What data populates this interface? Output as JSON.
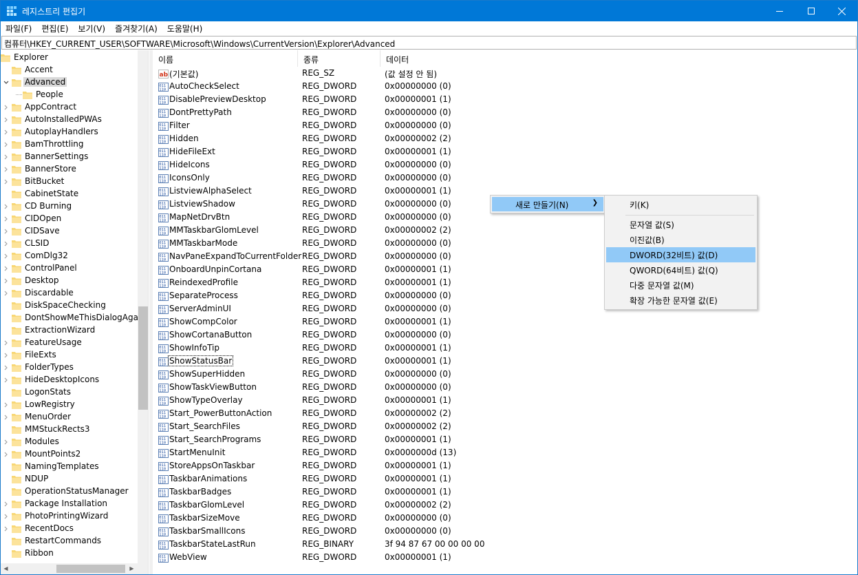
{
  "window": {
    "title": "레지스트리 편집기",
    "controls": {
      "minimize": "minimize-icon",
      "maximize": "maximize-icon",
      "close": "close-icon"
    }
  },
  "menubar": [
    "파일(F)",
    "편집(E)",
    "보기(V)",
    "즐겨찾기(A)",
    "도움말(H)"
  ],
  "address": "컴퓨터\\HKEY_CURRENT_USER\\SOFTWARE\\Microsoft\\Windows\\CurrentVersion\\Explorer\\Advanced",
  "tree": [
    {
      "label": "Explorer",
      "chevron": ""
    },
    {
      "label": "Accent",
      "chevron": ""
    },
    {
      "label": "Advanced",
      "chevron": "expanded",
      "selected": true
    },
    {
      "label": "People",
      "chevron": ""
    },
    {
      "label": "AppContract",
      "chevron": "collapsed"
    },
    {
      "label": "AutoInstalledPWAs",
      "chevron": "collapsed"
    },
    {
      "label": "AutoplayHandlers",
      "chevron": "collapsed"
    },
    {
      "label": "BamThrottling",
      "chevron": "collapsed"
    },
    {
      "label": "BannerSettings",
      "chevron": "collapsed"
    },
    {
      "label": "BannerStore",
      "chevron": "collapsed"
    },
    {
      "label": "BitBucket",
      "chevron": "collapsed"
    },
    {
      "label": "CabinetState",
      "chevron": ""
    },
    {
      "label": "CD Burning",
      "chevron": "collapsed"
    },
    {
      "label": "CIDOpen",
      "chevron": "collapsed"
    },
    {
      "label": "CIDSave",
      "chevron": "collapsed"
    },
    {
      "label": "CLSID",
      "chevron": "collapsed"
    },
    {
      "label": "ComDlg32",
      "chevron": "collapsed"
    },
    {
      "label": "ControlPanel",
      "chevron": "collapsed"
    },
    {
      "label": "Desktop",
      "chevron": "collapsed"
    },
    {
      "label": "Discardable",
      "chevron": "collapsed"
    },
    {
      "label": "DiskSpaceChecking",
      "chevron": ""
    },
    {
      "label": "DontShowMeThisDialogAgain",
      "chevron": ""
    },
    {
      "label": "ExtractionWizard",
      "chevron": ""
    },
    {
      "label": "FeatureUsage",
      "chevron": "collapsed"
    },
    {
      "label": "FileExts",
      "chevron": "collapsed"
    },
    {
      "label": "FolderTypes",
      "chevron": "collapsed"
    },
    {
      "label": "HideDesktopIcons",
      "chevron": "collapsed"
    },
    {
      "label": "LogonStats",
      "chevron": ""
    },
    {
      "label": "LowRegistry",
      "chevron": "collapsed"
    },
    {
      "label": "MenuOrder",
      "chevron": "collapsed"
    },
    {
      "label": "MMStuckRects3",
      "chevron": ""
    },
    {
      "label": "Modules",
      "chevron": "collapsed"
    },
    {
      "label": "MountPoints2",
      "chevron": "collapsed"
    },
    {
      "label": "NamingTemplates",
      "chevron": ""
    },
    {
      "label": "NDUP",
      "chevron": ""
    },
    {
      "label": "OperationStatusManager",
      "chevron": ""
    },
    {
      "label": "Package Installation",
      "chevron": "collapsed"
    },
    {
      "label": "PhotoPrintingWizard",
      "chevron": "collapsed"
    },
    {
      "label": "RecentDocs",
      "chevron": "collapsed"
    },
    {
      "label": "RestartCommands",
      "chevron": ""
    },
    {
      "label": "Ribbon",
      "chevron": ""
    }
  ],
  "list": {
    "columns": {
      "name": "이름",
      "type": "종류",
      "data": "데이터"
    },
    "rows": [
      {
        "icon": "string-value-icon",
        "name": "(기본값)",
        "type": "REG_SZ",
        "data": "(값 설정 안 됨)"
      },
      {
        "icon": "binary-value-icon",
        "name": "AutoCheckSelect",
        "type": "REG_DWORD",
        "data": "0x00000000 (0)"
      },
      {
        "icon": "binary-value-icon",
        "name": "DisablePreviewDesktop",
        "type": "REG_DWORD",
        "data": "0x00000001 (1)"
      },
      {
        "icon": "binary-value-icon",
        "name": "DontPrettyPath",
        "type": "REG_DWORD",
        "data": "0x00000000 (0)"
      },
      {
        "icon": "binary-value-icon",
        "name": "Filter",
        "type": "REG_DWORD",
        "data": "0x00000000 (0)"
      },
      {
        "icon": "binary-value-icon",
        "name": "Hidden",
        "type": "REG_DWORD",
        "data": "0x00000002 (2)"
      },
      {
        "icon": "binary-value-icon",
        "name": "HideFileExt",
        "type": "REG_DWORD",
        "data": "0x00000001 (1)"
      },
      {
        "icon": "binary-value-icon",
        "name": "HideIcons",
        "type": "REG_DWORD",
        "data": "0x00000000 (0)"
      },
      {
        "icon": "binary-value-icon",
        "name": "IconsOnly",
        "type": "REG_DWORD",
        "data": "0x00000000 (0)"
      },
      {
        "icon": "binary-value-icon",
        "name": "ListviewAlphaSelect",
        "type": "REG_DWORD",
        "data": "0x00000001 (1)"
      },
      {
        "icon": "binary-value-icon",
        "name": "ListviewShadow",
        "type": "REG_DWORD",
        "data": "0x00000000 (0)"
      },
      {
        "icon": "binary-value-icon",
        "name": "MapNetDrvBtn",
        "type": "REG_DWORD",
        "data": "0x00000000 (0)"
      },
      {
        "icon": "binary-value-icon",
        "name": "MMTaskbarGlomLevel",
        "type": "REG_DWORD",
        "data": "0x00000002 (2)"
      },
      {
        "icon": "binary-value-icon",
        "name": "MMTaskbarMode",
        "type": "REG_DWORD",
        "data": "0x00000000 (0)"
      },
      {
        "icon": "binary-value-icon",
        "name": "NavPaneExpandToCurrentFolder",
        "type": "REG_DWORD",
        "data": "0x00000000 (0)"
      },
      {
        "icon": "binary-value-icon",
        "name": "OnboardUnpinCortana",
        "type": "REG_DWORD",
        "data": "0x00000001 (1)"
      },
      {
        "icon": "binary-value-icon",
        "name": "ReindexedProfile",
        "type": "REG_DWORD",
        "data": "0x00000001 (1)"
      },
      {
        "icon": "binary-value-icon",
        "name": "SeparateProcess",
        "type": "REG_DWORD",
        "data": "0x00000000 (0)"
      },
      {
        "icon": "binary-value-icon",
        "name": "ServerAdminUI",
        "type": "REG_DWORD",
        "data": "0x00000000 (0)"
      },
      {
        "icon": "binary-value-icon",
        "name": "ShowCompColor",
        "type": "REG_DWORD",
        "data": "0x00000001 (1)"
      },
      {
        "icon": "binary-value-icon",
        "name": "ShowCortanaButton",
        "type": "REG_DWORD",
        "data": "0x00000000 (0)"
      },
      {
        "icon": "binary-value-icon",
        "name": "ShowInfoTip",
        "type": "REG_DWORD",
        "data": "0x00000001 (1)"
      },
      {
        "icon": "binary-value-icon",
        "name": "ShowStatusBar",
        "type": "REG_DWORD",
        "data": "0x00000001 (1)",
        "focused": true
      },
      {
        "icon": "binary-value-icon",
        "name": "ShowSuperHidden",
        "type": "REG_DWORD",
        "data": "0x00000000 (0)"
      },
      {
        "icon": "binary-value-icon",
        "name": "ShowTaskViewButton",
        "type": "REG_DWORD",
        "data": "0x00000000 (0)"
      },
      {
        "icon": "binary-value-icon",
        "name": "ShowTypeOverlay",
        "type": "REG_DWORD",
        "data": "0x00000001 (1)"
      },
      {
        "icon": "binary-value-icon",
        "name": "Start_PowerButtonAction",
        "type": "REG_DWORD",
        "data": "0x00000002 (2)"
      },
      {
        "icon": "binary-value-icon",
        "name": "Start_SearchFiles",
        "type": "REG_DWORD",
        "data": "0x00000002 (2)"
      },
      {
        "icon": "binary-value-icon",
        "name": "Start_SearchPrograms",
        "type": "REG_DWORD",
        "data": "0x00000001 (1)"
      },
      {
        "icon": "binary-value-icon",
        "name": "StartMenuInit",
        "type": "REG_DWORD",
        "data": "0x0000000d (13)"
      },
      {
        "icon": "binary-value-icon",
        "name": "StoreAppsOnTaskbar",
        "type": "REG_DWORD",
        "data": "0x00000001 (1)"
      },
      {
        "icon": "binary-value-icon",
        "name": "TaskbarAnimations",
        "type": "REG_DWORD",
        "data": "0x00000001 (1)"
      },
      {
        "icon": "binary-value-icon",
        "name": "TaskbarBadges",
        "type": "REG_DWORD",
        "data": "0x00000001 (1)"
      },
      {
        "icon": "binary-value-icon",
        "name": "TaskbarGlomLevel",
        "type": "REG_DWORD",
        "data": "0x00000002 (2)"
      },
      {
        "icon": "binary-value-icon",
        "name": "TaskbarSizeMove",
        "type": "REG_DWORD",
        "data": "0x00000000 (0)"
      },
      {
        "icon": "binary-value-icon",
        "name": "TaskbarSmallIcons",
        "type": "REG_DWORD",
        "data": "0x00000000 (0)"
      },
      {
        "icon": "binary-value-icon",
        "name": "TaskbarStateLastRun",
        "type": "REG_BINARY",
        "data": "3f 94 87 67 00 00 00 00"
      },
      {
        "icon": "binary-value-icon",
        "name": "WebView",
        "type": "REG_DWORD",
        "data": "0x00000001 (1)"
      }
    ]
  },
  "context_menu": {
    "parent_item": "새로 만들기(N)",
    "submenu": {
      "key": "키(K)",
      "items": [
        "문자열 값(S)",
        "이진값(B)",
        "DWORD(32비트) 값(D)",
        "QWORD(64비트) 값(Q)",
        "다중 문자열 값(M)",
        "확장 가능한 문자열 값(E)"
      ],
      "highlighted_index": 2
    }
  },
  "colors": {
    "titlebar": "#0078d7",
    "menu_highlight": "#91c9f7",
    "folder": "#f8d775",
    "tree_selected": "#d9d9d9"
  }
}
